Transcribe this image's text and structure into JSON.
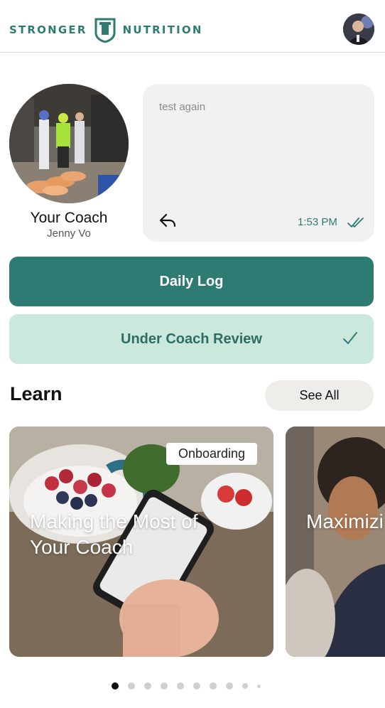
{
  "header": {
    "brand_left": "STRONGER",
    "brand_right": "NUTRITION",
    "logo_icon": "shield-logo-icon",
    "avatar_icon": "user-avatar"
  },
  "coach": {
    "title": "Your Coach",
    "name": "Jenny Vo",
    "message": {
      "text": "test again",
      "time": "1:53 PM",
      "reply_icon": "reply-icon",
      "status_icon": "double-check-icon"
    }
  },
  "actions": {
    "daily_log": "Daily Log",
    "review_status": "Under Coach Review",
    "review_icon": "check-icon"
  },
  "learn": {
    "title": "Learn",
    "see_all": "See All",
    "cards": [
      {
        "title": "Making the Most of Your Coach",
        "tag": "Onboarding"
      },
      {
        "title": "Maximizi Check-In"
      }
    ],
    "pager": {
      "total": 10,
      "active": 0
    }
  },
  "colors": {
    "brand": "#2e7b74",
    "review_bg": "#cbe8dd",
    "bubble_bg": "#f1f1f1",
    "see_all_bg": "#efedea"
  }
}
